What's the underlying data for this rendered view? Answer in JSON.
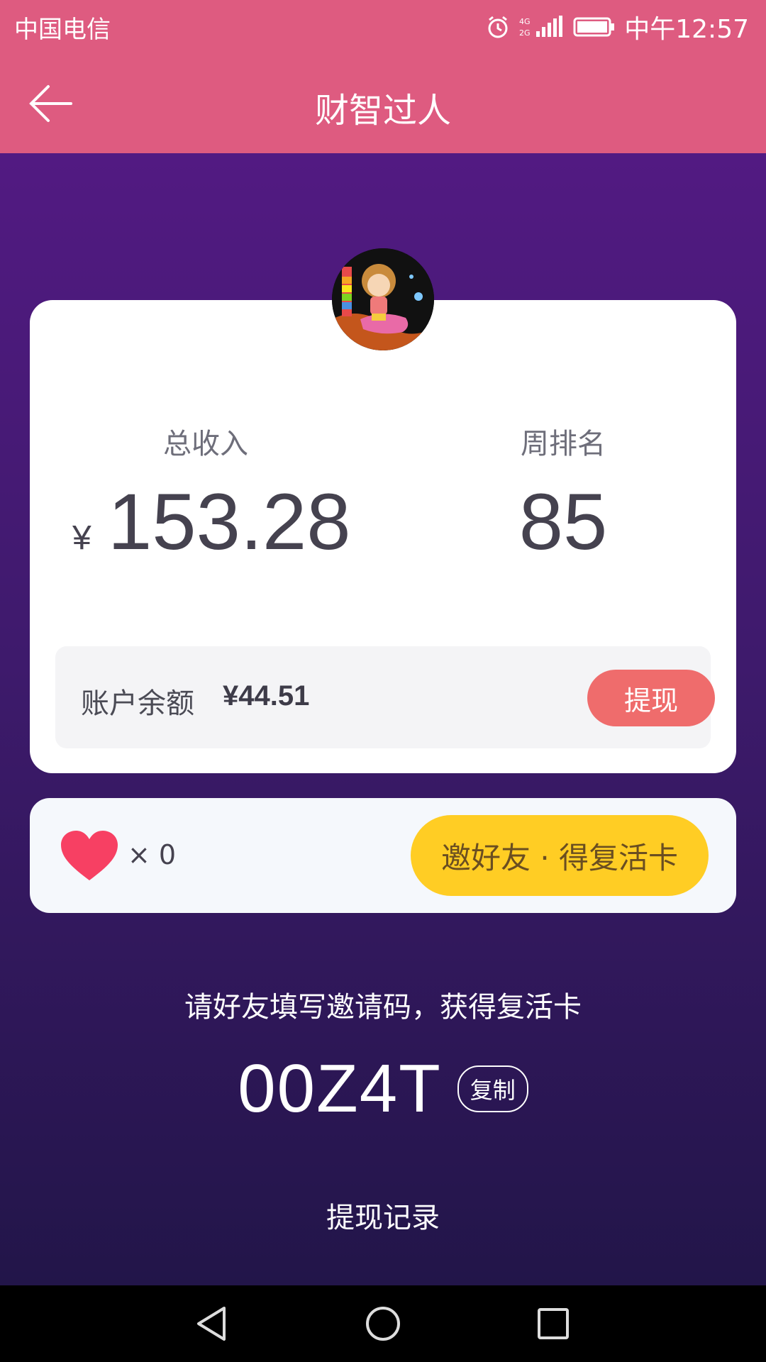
{
  "status_bar": {
    "carrier": "中国电信",
    "network": "4G 2G",
    "time": "中午12:57",
    "icons": [
      "alarm-icon",
      "signal-icon",
      "battery-icon"
    ]
  },
  "app_bar": {
    "title": "财智过人",
    "back_icon": "arrow-left-icon"
  },
  "stats": {
    "total_income_label": "总收入",
    "currency_symbol": "¥",
    "total_income_value": "153.28",
    "weekly_rank_label": "周排名",
    "weekly_rank_value": "85"
  },
  "balance": {
    "label": "账户余额",
    "amount": "¥44.51",
    "withdraw_label": "提现"
  },
  "lives": {
    "icon": "heart-icon",
    "count_text": "× 0",
    "invite_button_label": "邀好友 · 得复活卡"
  },
  "invite": {
    "hint": "请好友填写邀请码，获得复活卡",
    "code": "00Z4T",
    "copy_label": "复制"
  },
  "records_link": "提现记录",
  "nav": {
    "icons": [
      "back-triangle-icon",
      "home-circle-icon",
      "recents-square-icon"
    ]
  },
  "colors": {
    "header_pink": "#de5b80",
    "purple_top": "#521a82",
    "purple_bottom": "#221549",
    "withdraw_button": "#ef6c6c",
    "invite_button": "#ffcd24",
    "heart": "#f74063"
  }
}
